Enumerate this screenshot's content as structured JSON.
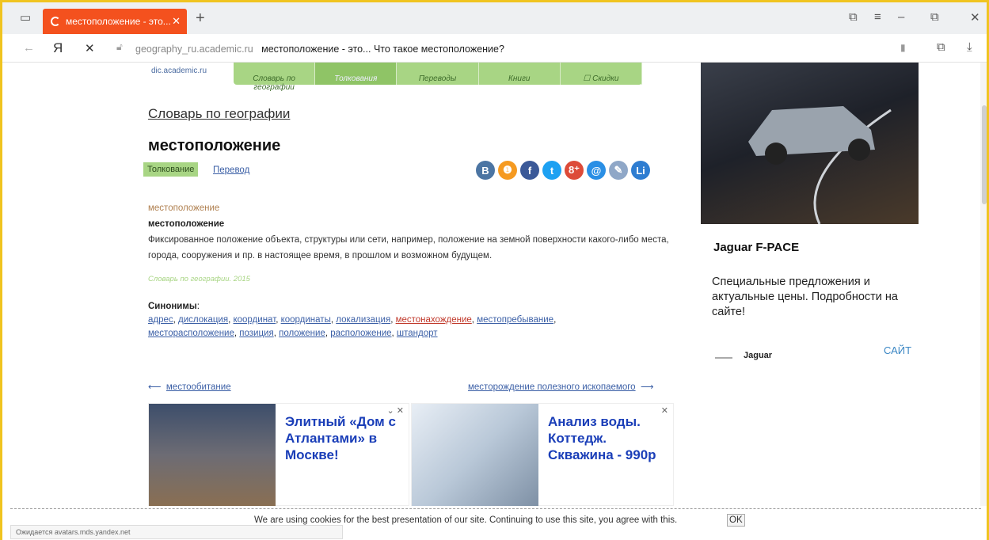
{
  "browser": {
    "tab_title": "местоположение - это...",
    "address_domain": "geography_ru.academic.ru",
    "address_title": "местоположение - это... Что такое местоположение?"
  },
  "site": {
    "logo": "dic.academic.ru",
    "nav": [
      "Словарь по географии",
      "Толкования",
      "Переводы",
      "Книги",
      "☐ Скидки"
    ],
    "dict_title": "Словарь по географии",
    "headword": "местоположение",
    "tab_active": "Толкование",
    "tab_other": "Перевод"
  },
  "social": [
    {
      "name": "vk-icon",
      "glyph": "B",
      "color": "#4c75a3"
    },
    {
      "name": "odnoklassniki-icon",
      "glyph": "❶",
      "color": "#f59a21"
    },
    {
      "name": "facebook-icon",
      "glyph": "f",
      "color": "#3b5998"
    },
    {
      "name": "twitter-icon",
      "glyph": "t",
      "color": "#1da1f2"
    },
    {
      "name": "googleplus-icon",
      "glyph": "8⁺",
      "color": "#dd4b39"
    },
    {
      "name": "mail-icon",
      "glyph": "@",
      "color": "#2a8fe5"
    },
    {
      "name": "livejournal-icon",
      "glyph": "✎",
      "color": "#8fa7c7"
    },
    {
      "name": "liveinternet-icon",
      "glyph": "Li",
      "color": "#2e7dd1"
    }
  ],
  "article": {
    "hw_small": "местоположение",
    "hw_bold": "местоположение",
    "definition": "Фиксированное положение объекта, структуры или сети, например, положение на земной поверхности какого-либо места, города, сооружения и пр. в настоящее время, в прошлом и возможном будущем.",
    "source": "Словарь по географии. 2015"
  },
  "synonyms": {
    "label": "Синонимы",
    "items": [
      "адрес",
      "дислокация",
      "координат",
      "координаты",
      "локализация",
      "местонахождение",
      "местопребывание",
      "месторасположение",
      "позиция",
      "положение",
      "расположение",
      "штандорт"
    ]
  },
  "nav_links": {
    "prev": "местообитание",
    "next": "месторождение полезного ископаемого"
  },
  "ads": [
    {
      "text": "Элитный «Дом с Атлантами» в Москве!"
    },
    {
      "text": "Анализ воды. Коттедж. Скважина - 990р"
    }
  ],
  "sidebar_ad": {
    "name": "Jaguar F-PACE",
    "desc": "Специальные предложения и актуальные цены. Подробности на сайте!",
    "brand": "Jaguar",
    "cta": "САЙТ"
  },
  "cookie": {
    "text": "We are using cookies for the best presentation of our site. Continuing to use this site, you agree with this.",
    "ok": "OK"
  },
  "status": "Ожидается avatars.mds.yandex.net"
}
